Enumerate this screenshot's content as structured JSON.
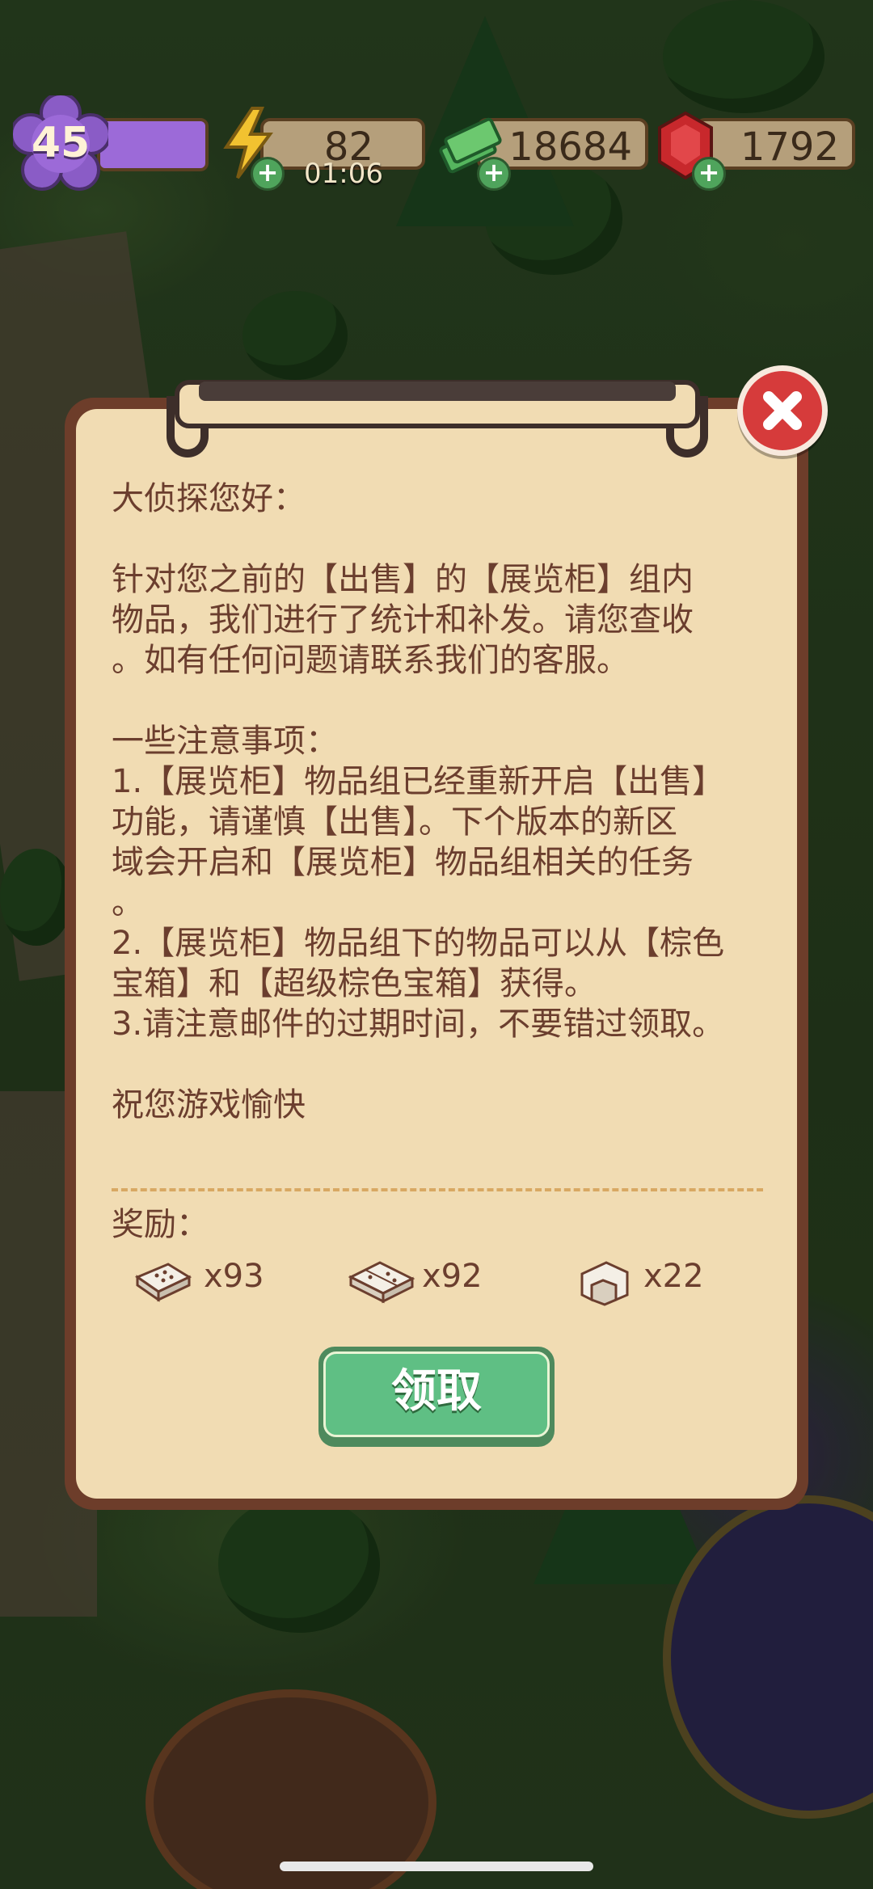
{
  "hud": {
    "level": "45",
    "energy": "82",
    "energy_timer": "01:06",
    "cash": "18684",
    "gems": "1792"
  },
  "mail": {
    "greeting": "大侦探您好：",
    "body_1": "针对您之前的【出售】的【展览柜】组内\n物品，我们进行了统计和补发。请您查收\n。如有任何问题请联系我们的客服。",
    "notes_title": "一些注意事项：",
    "note_1": "1.【展览柜】物品组已经重新开启【出售】\n功能，请谨慎【出售】。下个版本的新区\n域会开启和【展览柜】物品组相关的任务\n。",
    "note_2": "2.【展览柜】物品组下的物品可以从【棕色\n宝箱】和【超级棕色宝箱】获得。",
    "note_3": "3.请注意邮件的过期时间，不要错过领取。",
    "closing": "祝您游戏愉快",
    "rewards_label": "奖励：",
    "rewards": [
      {
        "icon": "single-tile-icon",
        "qty": "x93"
      },
      {
        "icon": "double-tile-icon",
        "qty": "x92"
      },
      {
        "icon": "corner-piece-icon",
        "qty": "x22"
      }
    ],
    "claim_label": "领取"
  },
  "colors": {
    "panel_border": "#6d3d2a",
    "panel_paper": "#f1dcb3",
    "text": "#6b3e2e",
    "claim_button": "#5fbf84",
    "close_button": "#d63b3b",
    "level_badge": "#8a5cc6"
  }
}
